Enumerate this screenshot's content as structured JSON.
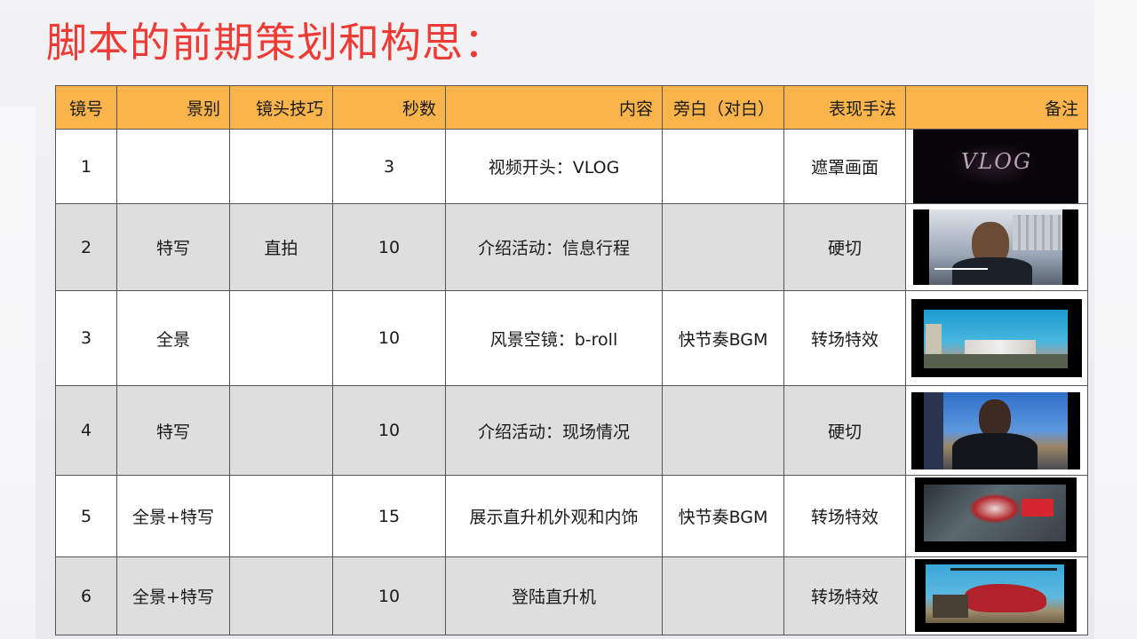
{
  "title": "脚本的前期策划和构思：",
  "table": {
    "headers": [
      "镜号",
      "景别",
      "镜头技巧",
      "秒数",
      "内容",
      "旁白（对白）",
      "表现手法",
      "备注"
    ],
    "rows": [
      {
        "no": "1",
        "shot": "",
        "technique": "",
        "seconds": "3",
        "content": "视频开头：VLOG",
        "narration": "",
        "method": "遮罩画面",
        "thumb": "vlog-title-frame"
      },
      {
        "no": "2",
        "shot": "特写",
        "technique": "直拍",
        "seconds": "10",
        "content": "介绍活动：信息行程",
        "narration": "",
        "method": "硬切",
        "thumb": "presenter-closeup-frame"
      },
      {
        "no": "3",
        "shot": "全景",
        "technique": "",
        "seconds": "10",
        "content": "风景空镜：b-roll",
        "narration": "快节奏BGM",
        "method": "转场特效",
        "thumb": "landscape-frame"
      },
      {
        "no": "4",
        "shot": "特写",
        "technique": "",
        "seconds": "10",
        "content": "介绍活动：现场情况",
        "narration": "",
        "method": "硬切",
        "thumb": "presenter-outdoor-frame"
      },
      {
        "no": "5",
        "shot": "全景+特写",
        "technique": "",
        "seconds": "15",
        "content": "展示直升机外观和内饰",
        "narration": "快节奏BGM",
        "method": "转场特效",
        "thumb": "helicopter-exterior-frame"
      },
      {
        "no": "6",
        "shot": "全景+特写",
        "technique": "",
        "seconds": "10",
        "content": "登陆直升机",
        "narration": "",
        "method": "转场特效",
        "thumb": "helicopter-boarding-frame"
      }
    ]
  },
  "thumb_text": {
    "vlog": "VLOG"
  }
}
